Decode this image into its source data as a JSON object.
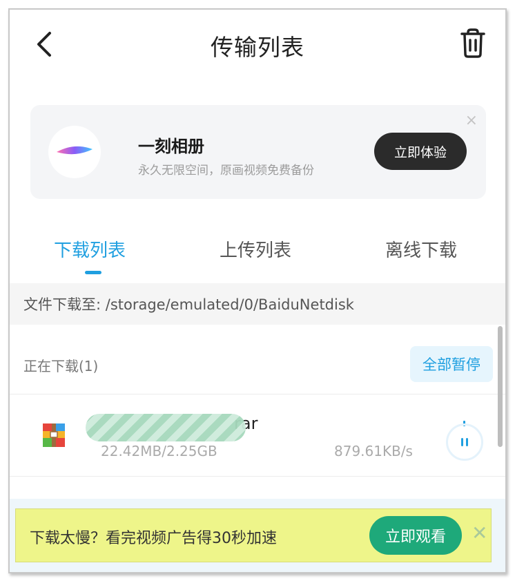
{
  "header": {
    "title": "传输列表",
    "back_icon": "chevron-left-icon",
    "trash_icon": "trash-icon"
  },
  "promo": {
    "name": "一刻相册",
    "description": "永久无限空间，原画视频免费备份",
    "button_label": "立即体验",
    "close_label": "×"
  },
  "tabs": [
    {
      "label": "下载列表",
      "active": true
    },
    {
      "label": "上传列表",
      "active": false
    },
    {
      "label": "离线下载",
      "active": false
    }
  ],
  "path": {
    "text": "文件下载至: /storage/emulated/0/BaiduNetdisk"
  },
  "downloading": {
    "title": "正在下载(1)",
    "pause_all_label": "全部暂停",
    "items": [
      {
        "name": "...rar",
        "name_suffix": "rar",
        "size": "22.42MB/2.25GB",
        "speed": "879.61KB/s",
        "progress": 0.0097
      }
    ]
  },
  "banner": {
    "text": "下载太慢？看完视频广告得30秒加速",
    "button_label": "立即观看",
    "close_label": "✕"
  },
  "colors": {
    "accent": "#1f9fe0",
    "banner_bg": "#eef58a",
    "banner_button": "#1ea97a",
    "promo_button": "#2b2b2b"
  }
}
